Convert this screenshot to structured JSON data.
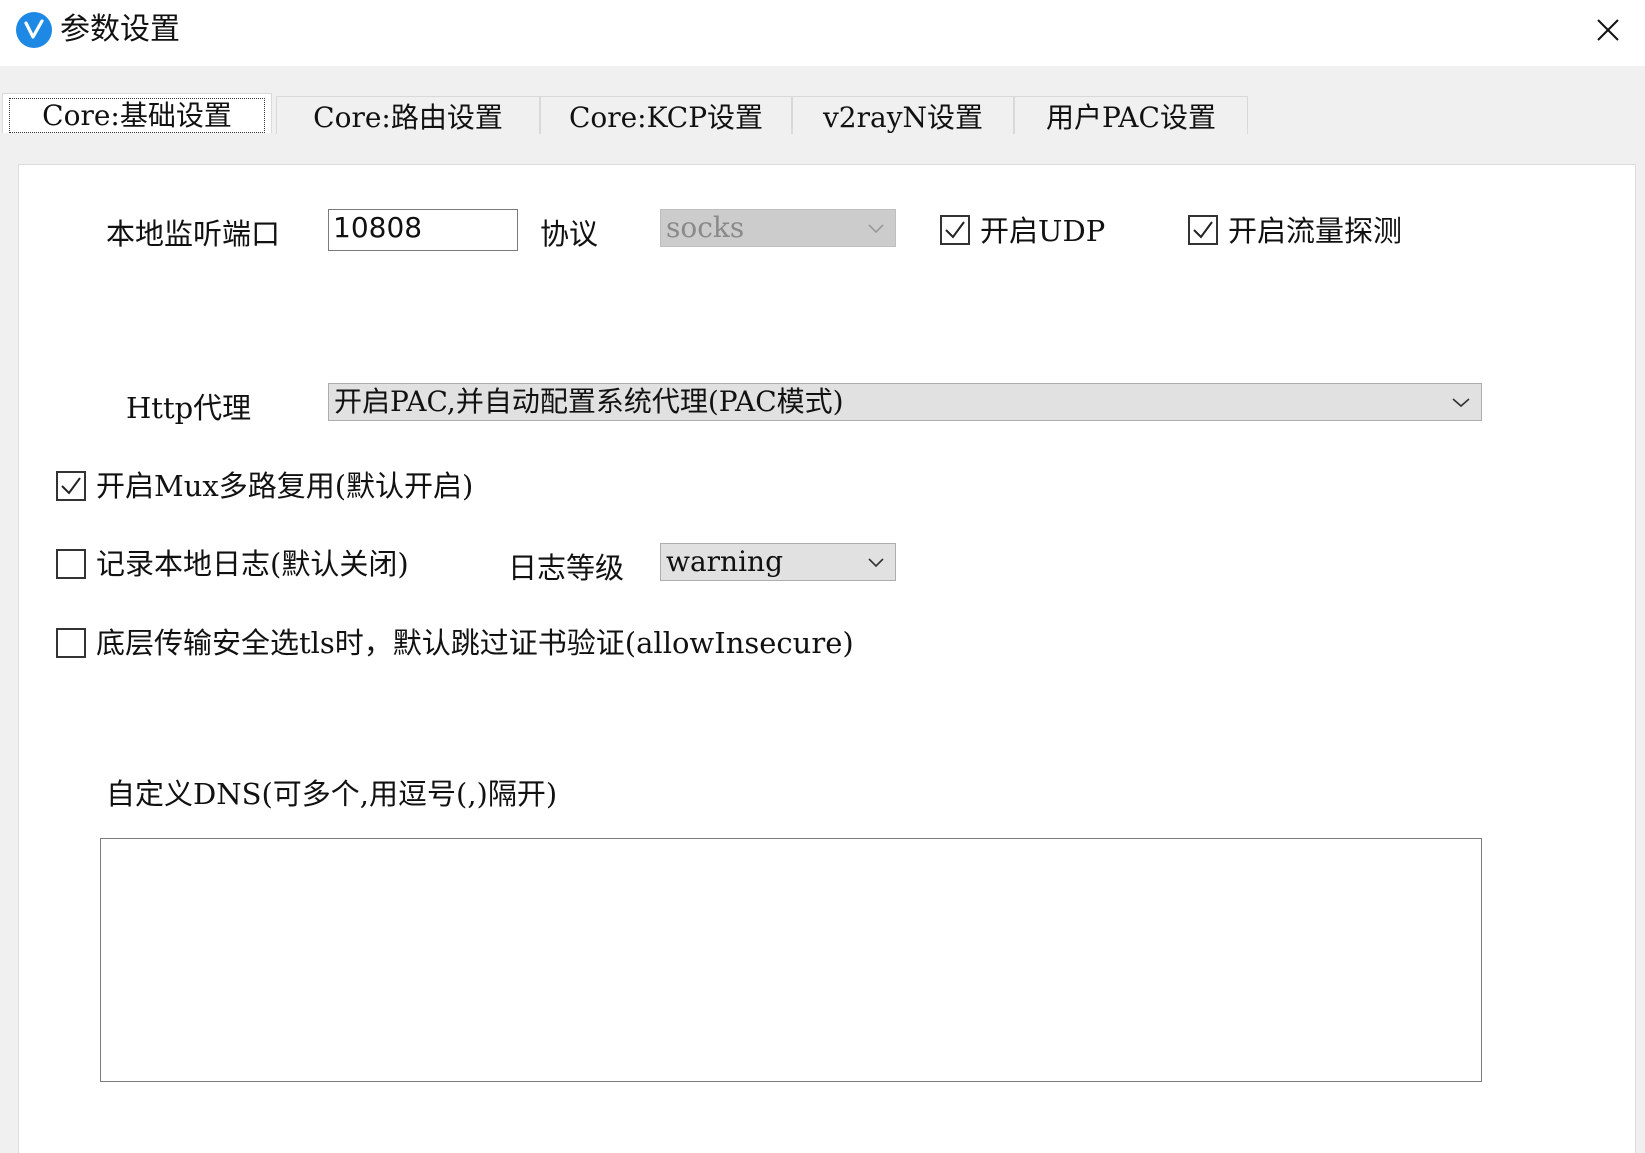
{
  "window": {
    "title": "参数设置",
    "app_icon": "v2rayn-logo-icon",
    "close_icon": "close-icon"
  },
  "tabs": [
    {
      "label": "Core:基础设置",
      "active": true
    },
    {
      "label": "Core:路由设置",
      "active": false
    },
    {
      "label": "Core:KCP设置",
      "active": false
    },
    {
      "label": "v2rayN设置",
      "active": false
    },
    {
      "label": "用户PAC设置",
      "active": false
    }
  ],
  "basic": {
    "local_port_label": "本地监听端口",
    "local_port_value": "10808",
    "protocol_label": "协议",
    "protocol_value": "socks",
    "enable_udp_label": "开启UDP",
    "enable_udp_checked": true,
    "enable_sniffing_label": "开启流量探测",
    "enable_sniffing_checked": true,
    "http_proxy_label": "Http代理",
    "http_proxy_value": "开启PAC,并自动配置系统代理(PAC模式)",
    "mux_label": "开启Mux多路复用(默认开启)",
    "mux_checked": true,
    "log_label": "记录本地日志(默认关闭)",
    "log_checked": false,
    "log_level_label": "日志等级",
    "log_level_value": "warning",
    "allow_insecure_label": "底层传输安全选tls时，默认跳过证书验证(allowInsecure)",
    "allow_insecure_checked": false,
    "custom_dns_label": "自定义DNS(可多个,用逗号(,)隔开)",
    "custom_dns_value": ""
  },
  "colors": {
    "accent": "#1e88e5",
    "tab_strip": "#f0f0f0",
    "combo_bg": "#e1e1e1",
    "combo_disabled_bg": "#cccccc"
  }
}
